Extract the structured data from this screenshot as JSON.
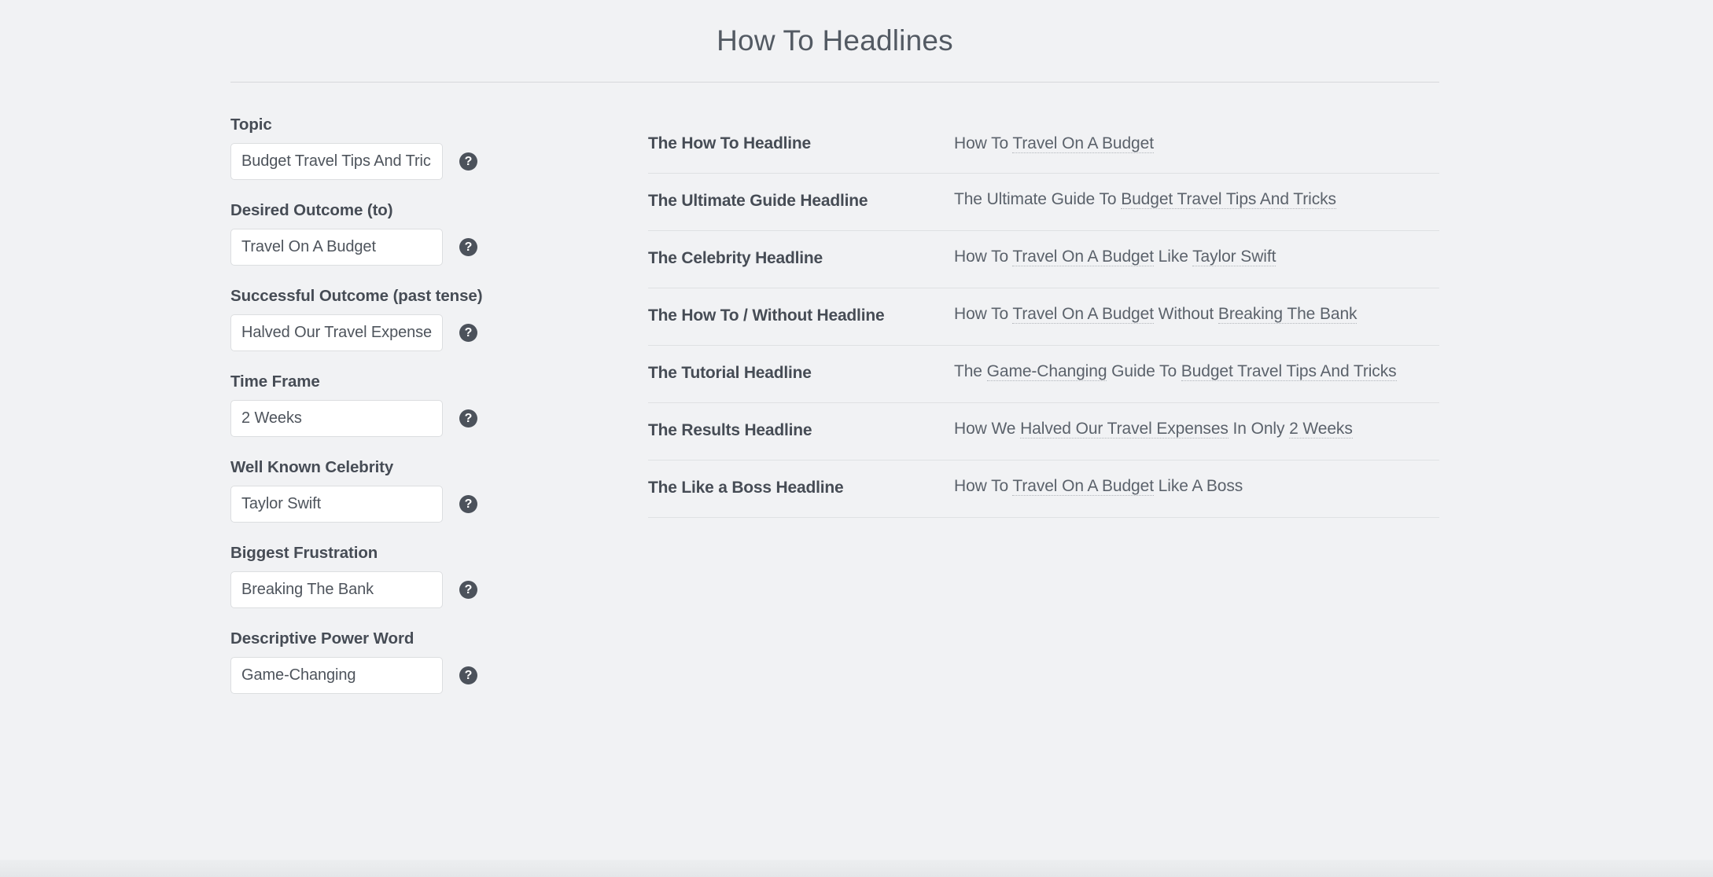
{
  "header": {
    "title": "How To Headlines"
  },
  "form": {
    "help_icon_glyph": "?",
    "help_icon_name": "question-mark-circle-icon",
    "fields": [
      {
        "label": "Topic",
        "value": "Budget Travel Tips And Tricks",
        "placeholder": "Topic",
        "name": "topic"
      },
      {
        "label": "Desired Outcome (to)",
        "value": "Travel On A Budget",
        "placeholder": "Desired Outcome (to)",
        "name": "desired-outcome"
      },
      {
        "label": "Successful Outcome (past tense)",
        "value": "Halved Our Travel Expenses",
        "placeholder": "Successful Outcome (past tense)",
        "name": "successful-outcome"
      },
      {
        "label": "Time Frame",
        "value": "2 Weeks",
        "placeholder": "Time Frame",
        "name": "time-frame"
      },
      {
        "label": "Well Known Celebrity",
        "value": "Taylor Swift",
        "placeholder": "Well Known Celebrity",
        "name": "well-known-celebrity"
      },
      {
        "label": "Biggest Frustration",
        "value": "Breaking The Bank",
        "placeholder": "Biggest Frustration",
        "name": "biggest-frustration"
      },
      {
        "label": "Descriptive Power Word",
        "value": "Game-Changing",
        "placeholder": "Descriptive Power Word",
        "name": "descriptive-power-word"
      }
    ]
  },
  "results": {
    "rows": [
      {
        "label": "The How To Headline",
        "value": "How To Travel On A Budget",
        "segments": [
          {
            "text": "How To ",
            "variable": false
          },
          {
            "text": "Travel On A Budget",
            "variable": true
          }
        ]
      },
      {
        "label": "The Ultimate Guide Headline",
        "value": "The Ultimate Guide To Budget Travel Tips And Tricks",
        "segments": [
          {
            "text": "The Ultimate Guide To ",
            "variable": false
          },
          {
            "text": "Budget Travel Tips And Tricks",
            "variable": true
          }
        ]
      },
      {
        "label": "The Celebrity Headline",
        "value": "How To Travel On A Budget Like Taylor Swift",
        "segments": [
          {
            "text": "How To ",
            "variable": false
          },
          {
            "text": "Travel On A Budget",
            "variable": true
          },
          {
            "text": " Like ",
            "variable": false
          },
          {
            "text": "Taylor Swift",
            "variable": true
          }
        ]
      },
      {
        "label": "The How To / Without Headline",
        "value": "How To Travel On A Budget Without Breaking The Bank",
        "segments": [
          {
            "text": "How To ",
            "variable": false
          },
          {
            "text": "Travel On A Budget",
            "variable": true
          },
          {
            "text": " Without ",
            "variable": false
          },
          {
            "text": "Breaking The Bank",
            "variable": true
          }
        ]
      },
      {
        "label": "The Tutorial Headline",
        "value": "The Game-Changing Guide To Budget Travel Tips And Tricks",
        "segments": [
          {
            "text": "The ",
            "variable": false
          },
          {
            "text": "Game-Changing",
            "variable": true
          },
          {
            "text": " Guide To ",
            "variable": false
          },
          {
            "text": "Budget Travel Tips And Tricks",
            "variable": true
          }
        ]
      },
      {
        "label": "The Results Headline",
        "value": "How We Halved Our Travel Expenses In Only 2 Weeks",
        "segments": [
          {
            "text": "How We ",
            "variable": false
          },
          {
            "text": "Halved Our Travel Expenses",
            "variable": true
          },
          {
            "text": " In Only ",
            "variable": false
          },
          {
            "text": "2 Weeks",
            "variable": true
          }
        ]
      },
      {
        "label": "The Like a Boss Headline",
        "value": "How To Travel On A Budget Like A Boss",
        "segments": [
          {
            "text": "How To ",
            "variable": false
          },
          {
            "text": "Travel On A Budget",
            "variable": true
          },
          {
            "text": " Like A Boss",
            "variable": false
          }
        ]
      }
    ]
  },
  "colors": {
    "background": "#f1f2f4",
    "text_primary": "#464c55",
    "text_secondary": "#5b626b",
    "divider": "#dfe1e3",
    "input_border": "#dcdee0",
    "input_background": "#ffffff",
    "help_icon_background": "#4c525b"
  }
}
